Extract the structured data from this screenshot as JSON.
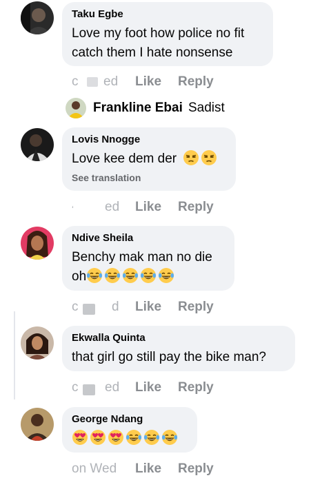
{
  "comments": [
    {
      "author": "Taku Egbe",
      "lines": [
        "Love my foot how police no fit",
        "catch them I hate nonsense"
      ],
      "actions": {
        "timestamp": "ed",
        "like": "Like",
        "reply": "Reply"
      }
    },
    {
      "author": "Lovis Nnogge",
      "lines": [
        "Love kee dem der"
      ],
      "emojis": [
        "unamused-face",
        "unamused-face"
      ],
      "see_translation": "See translation",
      "actions": {
        "timestamp": "ed",
        "like": "Like",
        "reply": "Reply"
      }
    },
    {
      "author": "Ndive Sheila",
      "lines": [
        "Benchy mak man no die",
        "oh"
      ],
      "emojis": [
        "joy-face",
        "joy-face",
        "joy-face",
        "joy-face",
        "joy-face"
      ],
      "actions": {
        "timestamp": "d",
        "like": "Like",
        "reply": "Reply"
      }
    },
    {
      "author": "Ekwalla Quinta",
      "lines": [
        "that girl go still pay the bike man?"
      ],
      "actions": {
        "timestamp": "ed",
        "like": "Like",
        "reply": "Reply"
      }
    },
    {
      "author": "George Ndang",
      "emojis": [
        "heart-eyes-face",
        "heart-eyes-face",
        "heart-eyes-face",
        "joy-face",
        "joy-face",
        "joy-face"
      ],
      "actions": {
        "timestamp": "on Wed",
        "like": "Like",
        "reply": "Reply"
      }
    }
  ],
  "reply": {
    "author": "Frankline Ebai",
    "text": "Sadist"
  },
  "colors": {
    "bubble": "#f0f2f5",
    "action_text": "#8a8d91",
    "name_text": "#050505",
    "secondary_text": "#65676b",
    "emoji_yellow": "#ffcc4d",
    "heart_red": "#e0245e",
    "tear_blue": "#5dadec"
  }
}
